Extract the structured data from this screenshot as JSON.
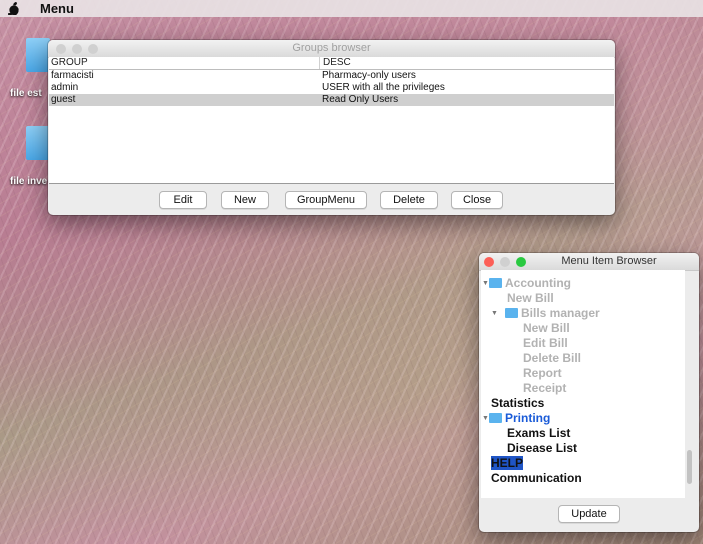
{
  "menubar": {
    "title": "Menu",
    "icon": "apple-icon"
  },
  "desktop": {
    "icons": [
      {
        "label": "file est"
      },
      {
        "label": "file inve"
      }
    ]
  },
  "groups_window": {
    "title": "Groups browser",
    "columns": [
      "GROUP",
      "DESC"
    ],
    "rows": [
      {
        "group": "farmacisti",
        "desc": "Pharmacy-only users"
      },
      {
        "group": "admin",
        "desc": "USER with all the privileges"
      },
      {
        "group": "guest",
        "desc": "Read Only Users"
      }
    ],
    "selected_row": 2,
    "buttons": {
      "edit": "Edit",
      "new": "New",
      "groupmenu": "GroupMenu",
      "delete": "Delete",
      "close": "Close"
    }
  },
  "menu_item_window": {
    "title": "Menu Item Browser",
    "tree": {
      "accounting": "Accounting",
      "new_bill": "New Bill",
      "bills_manager": "Bills manager",
      "new_bill_2": "New Bill",
      "edit_bill": "Edit Bill",
      "delete_bill": "Delete Bill",
      "report": "Report",
      "receipt": "Receipt",
      "statistics": "Statistics",
      "printing": "Printing",
      "exams_list": "Exams List",
      "disease_list": "Disease List",
      "help": "HELP",
      "communication": "Communication"
    },
    "update_label": "Update"
  },
  "colors": {
    "traffic_red": "#fc5f57",
    "traffic_yellow": "#fdbc2e",
    "traffic_green": "#29c940",
    "traffic_inactive": "#d0d0d0",
    "highlight": "#1f55c6",
    "link_blue": "#1a5bd8"
  }
}
